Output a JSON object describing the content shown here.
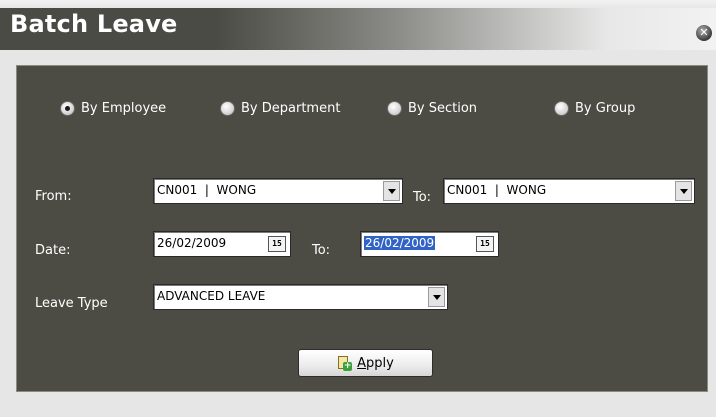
{
  "window": {
    "title": "Batch Leave",
    "close_icon": "x-circle-icon",
    "close_glyph": "✕"
  },
  "mode": {
    "options": [
      {
        "label": "By Employee",
        "selected": true
      },
      {
        "label": "By Department",
        "selected": false
      },
      {
        "label": "By Section",
        "selected": false
      },
      {
        "label": "By Group",
        "selected": false
      }
    ]
  },
  "form": {
    "from_label": "From:",
    "to_label_1": "To:",
    "from_value": "CN001  |  WONG",
    "to_value": "CN001  |  WONG",
    "date_label": "Date:",
    "to_label_2": "To:",
    "date_from": "26/02/2009",
    "date_to": "26/02/2009",
    "calendar_glyph": "15",
    "leave_type_label": "Leave Type",
    "leave_type_value": "ADVANCED LEAVE"
  },
  "actions": {
    "apply_label": "Apply",
    "apply_mnemonic": "A",
    "apply_rest": "pply",
    "plus_glyph": "+"
  }
}
